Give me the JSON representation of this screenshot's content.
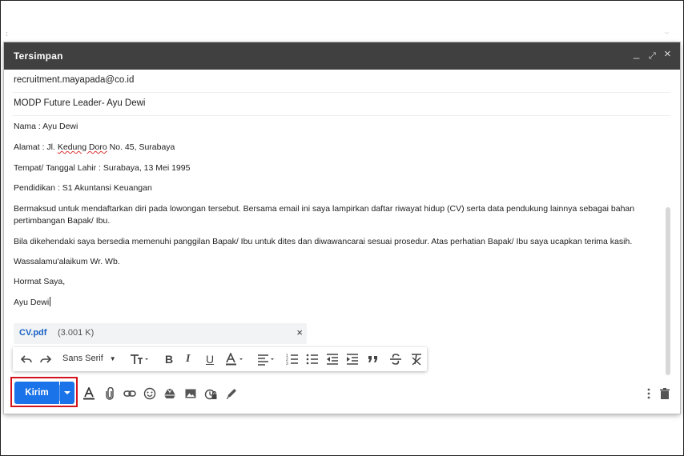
{
  "window": {
    "title": "Tersimpan",
    "minimize_label": "_",
    "expand_label": "⤢",
    "close_label": "×"
  },
  "compose": {
    "to": "recruitment.mayapada@co.id",
    "subject": "MODP Future Leader- Ayu Dewi"
  },
  "body": {
    "name_line": "Nama : Ayu Dewi",
    "address_prefix": "Alamat : Jl. ",
    "address_misspelled": "Kedung Doro",
    "address_suffix": " No. 45, Surabaya",
    "birth_line": "Tempat/ Tanggal Lahir : Surabaya, 13 Mei 1995",
    "education_line": "Pendidikan : S1 Akuntansi Keuangan",
    "paragraph1": "Bermaksud untuk mendaftarkan diri pada lowongan tersebut. Bersama email ini saya lampirkan daftar riwayat hidup (CV) serta data pendukung lainnya sebagai bahan pertimbangan Bapak/ Ibu.",
    "paragraph2": "Bila dikehendaki saya bersedia memenuhi panggilan Bapak/ Ibu untuk dites dan diwawancarai sesuai prosedur. Atas perhatian Bapak/ Ibu saya ucapkan terima kasih.",
    "closing1": "Wassalamu'alaikum Wr. Wb.",
    "closing2": "Hormat Saya,",
    "signature": "Ayu Dewi"
  },
  "attachment": {
    "name": "CV.pdf",
    "size": "(3.001 K)",
    "remove_label": "×"
  },
  "format_toolbar": {
    "font_name": "Sans Serif"
  },
  "actions": {
    "send_label": "Kirim"
  },
  "colors": {
    "accent": "#1a73e8",
    "titlebar": "#404040",
    "highlight_box": "#d3121c",
    "attachment_link": "#1a62c6"
  }
}
